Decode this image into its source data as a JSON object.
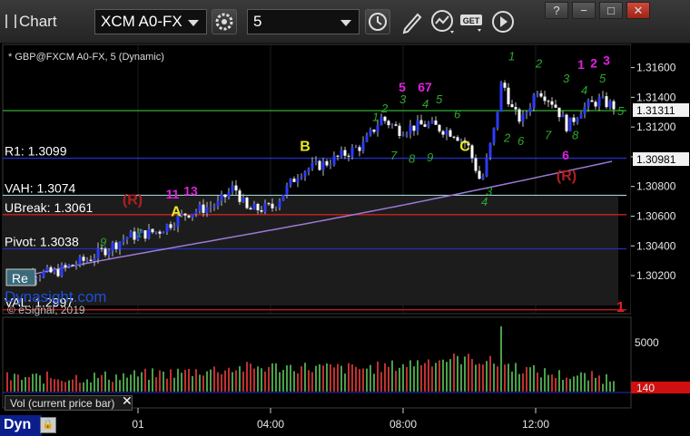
{
  "toolbar": {
    "title": "Chart",
    "symbol": "XCM A0-FX",
    "interval": "5"
  },
  "window_controls": {
    "help": "?",
    "restore": "−",
    "maximize": "□",
    "close": "✕"
  },
  "chart_data": [
    {
      "type": "candlestick",
      "title": "* GBP@FXCM A0-FX, 5 (Dynamic)",
      "watermark": "Dynasight.com",
      "copyright": "© eSignal, 2019",
      "ylim": [
        1.2995,
        1.3175
      ],
      "y_ticks": [
        "1.31600",
        "1.31400",
        "1.31200",
        "1.31000",
        "1.30800",
        "1.30600",
        "1.30400",
        "1.30200"
      ],
      "x_ticks": [
        "01",
        "04:00",
        "08:00",
        "12:00"
      ],
      "last_price": "1.31311",
      "vwap_price": "1.30981",
      "levels": [
        {
          "label": "R1: 1.3099",
          "value": 1.3099,
          "color": "#2030c0"
        },
        {
          "label": "VAH: 1.3074",
          "value": 1.3074,
          "color": "#9ad0d0"
        },
        {
          "label": "UBreak: 1.3061",
          "value": 1.3061,
          "color": "#d02020"
        },
        {
          "label": "Pivot: 1.3038",
          "value": 1.3038,
          "color": "#2030c0"
        },
        {
          "label": "VAL: 1.2997",
          "value": 1.2997,
          "color": "#d02020"
        }
      ],
      "reference_line": 1.3131,
      "annotations": [
        {
          "text": "B",
          "color": "#e8e820"
        },
        {
          "text": "C",
          "color": "#e8e820"
        },
        {
          "text": "A",
          "color": "#e8e820"
        },
        {
          "text": "(R)",
          "color": "#b02020"
        },
        {
          "text": "(R)",
          "color": "#b02020"
        },
        {
          "text": "5",
          "color": "#e020e0"
        },
        {
          "text": "67",
          "color": "#e020e0"
        },
        {
          "text": "1",
          "color": "#e020e0"
        },
        {
          "text": "2",
          "color": "#e020e0"
        },
        {
          "text": "3",
          "color": "#e020e0"
        },
        {
          "text": "11",
          "color": "#e020e0"
        },
        {
          "text": "13",
          "color": "#e020e0"
        },
        {
          "text": "6",
          "color": "#e020e0"
        },
        {
          "text": "1",
          "color": "#e02020"
        }
      ]
    },
    {
      "type": "bar",
      "title": "Vol (current price bar)",
      "y_ticks": [
        "5000"
      ],
      "current_value": "140"
    }
  ],
  "status": {
    "layout": "Dyn"
  },
  "colors": {
    "up": "#2a3cff",
    "down": "#ffffff",
    "accent_pink": "#e020e0",
    "volume_up": "#4aa04a",
    "volume_down": "#c03030"
  }
}
